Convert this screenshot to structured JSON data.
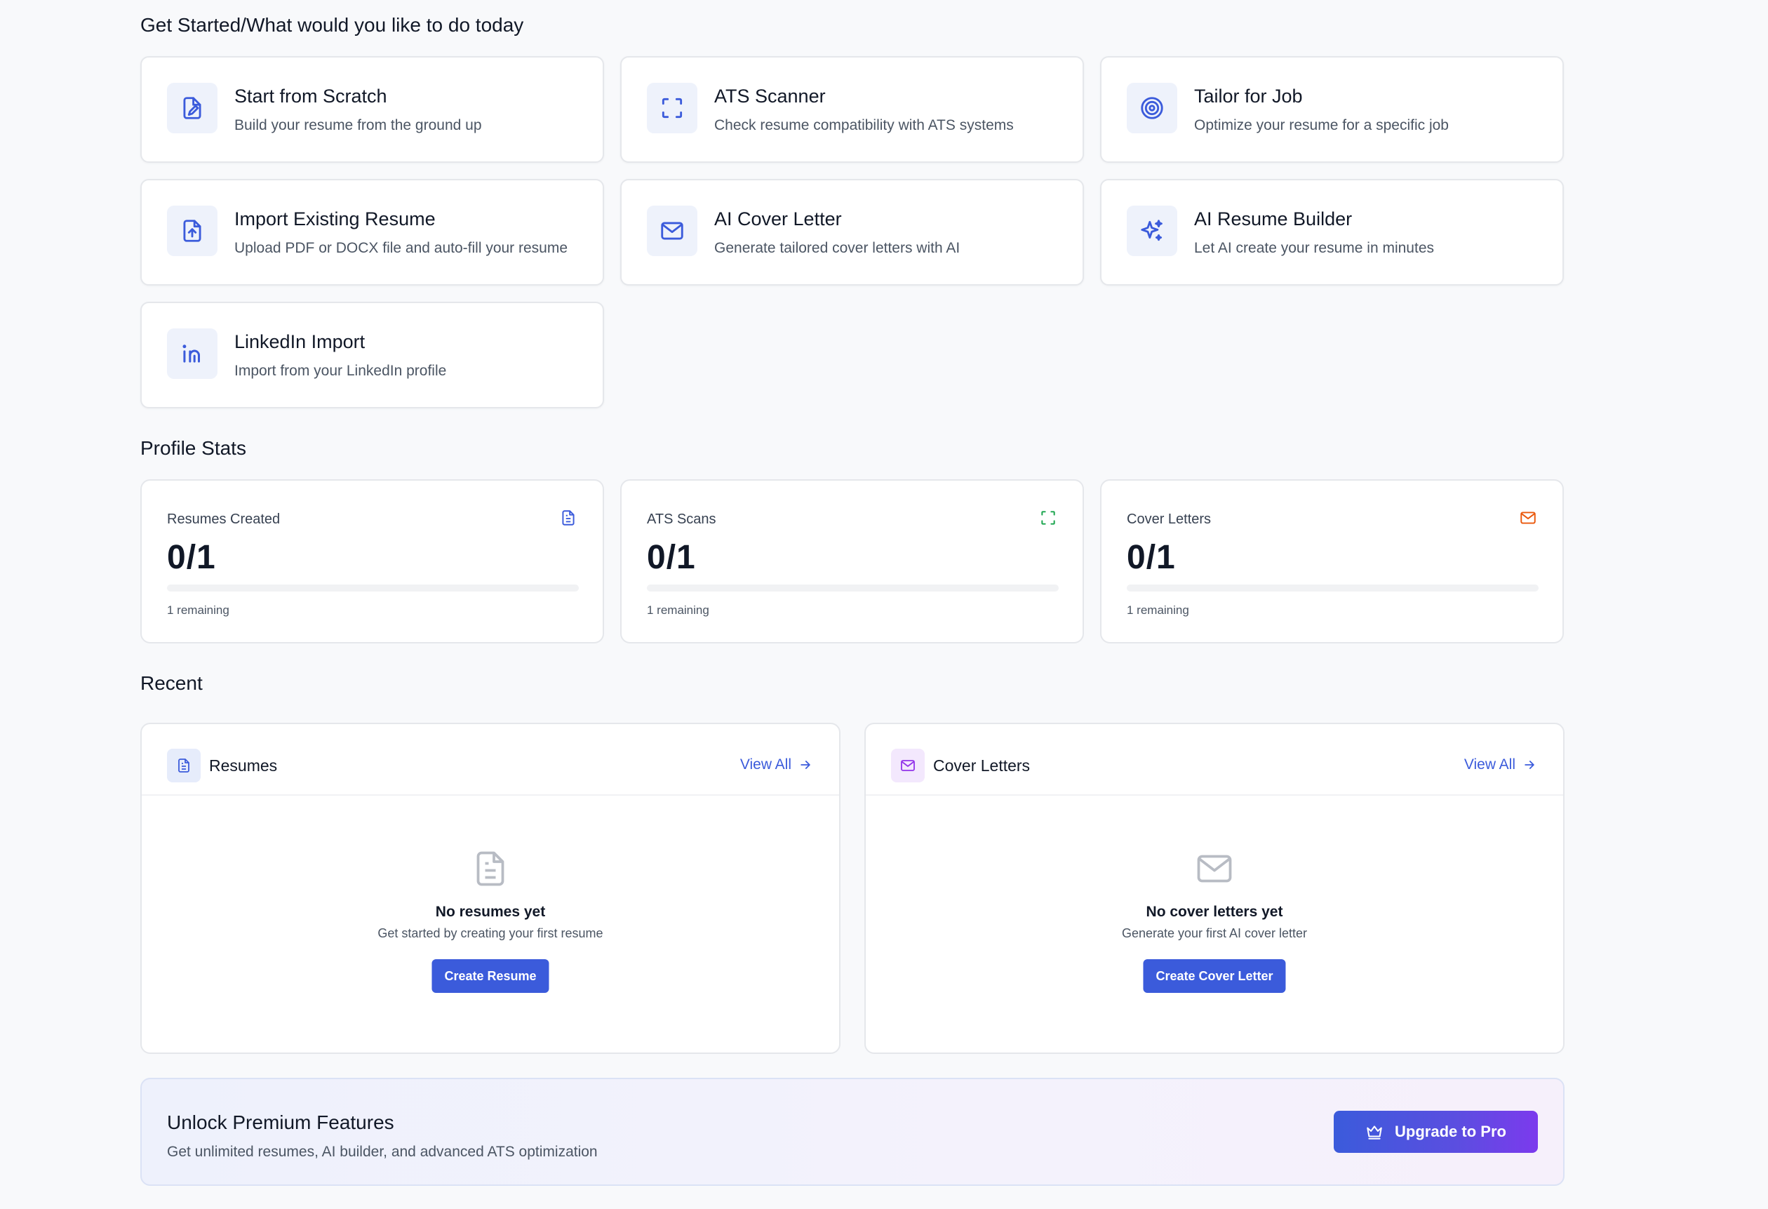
{
  "get_started": {
    "title": "Get Started/What would you like to do today",
    "cards": [
      {
        "title": "Start from Scratch",
        "desc": "Build your resume from the ground up",
        "icon": "file-pen-icon"
      },
      {
        "title": "ATS Scanner",
        "desc": "Check resume compatibility with ATS systems",
        "icon": "scan-icon"
      },
      {
        "title": "Tailor for Job",
        "desc": "Optimize your resume for a specific job",
        "icon": "target-icon"
      },
      {
        "title": "Import Existing Resume",
        "desc": "Upload PDF or DOCX file and auto-fill your resume",
        "icon": "file-upload-icon"
      },
      {
        "title": "AI Cover Letter",
        "desc": "Generate tailored cover letters with AI",
        "icon": "mail-icon"
      },
      {
        "title": "AI Resume Builder",
        "desc": "Let AI create your resume in minutes",
        "icon": "sparkles-icon"
      },
      {
        "title": "LinkedIn Import",
        "desc": "Import from your LinkedIn profile",
        "icon": "linkedin-icon"
      }
    ]
  },
  "profile_stats": {
    "title": "Profile Stats",
    "stats": [
      {
        "label": "Resumes Created",
        "value": "0/1",
        "remaining": "1 remaining",
        "progress": 0,
        "icon": "document-icon",
        "icon_color": "#3b5bdb"
      },
      {
        "label": "ATS Scans",
        "value": "0/1",
        "remaining": "1 remaining",
        "progress": 0,
        "icon": "scan-icon",
        "icon_color": "#16a34a"
      },
      {
        "label": "Cover Letters",
        "value": "0/1",
        "remaining": "1 remaining",
        "progress": 0,
        "icon": "mail-icon",
        "icon_color": "#ea580c"
      }
    ]
  },
  "recent": {
    "title": "Recent",
    "resumes": {
      "title": "Resumes",
      "view_all": "View All",
      "empty_title": "No resumes yet",
      "empty_desc": "Get started by creating your first resume",
      "button": "Create Resume"
    },
    "cover_letters": {
      "title": "Cover Letters",
      "view_all": "View All",
      "empty_title": "No cover letters yet",
      "empty_desc": "Generate your first AI cover letter",
      "button": "Create Cover Letter"
    }
  },
  "premium": {
    "title": "Unlock Premium Features",
    "desc": "Get unlimited resumes, AI builder, and advanced ATS optimization",
    "button": "Upgrade to Pro"
  },
  "colors": {
    "accent": "#3b5bdb",
    "purple": "#7c3aed",
    "background": "#f8f9fb"
  }
}
